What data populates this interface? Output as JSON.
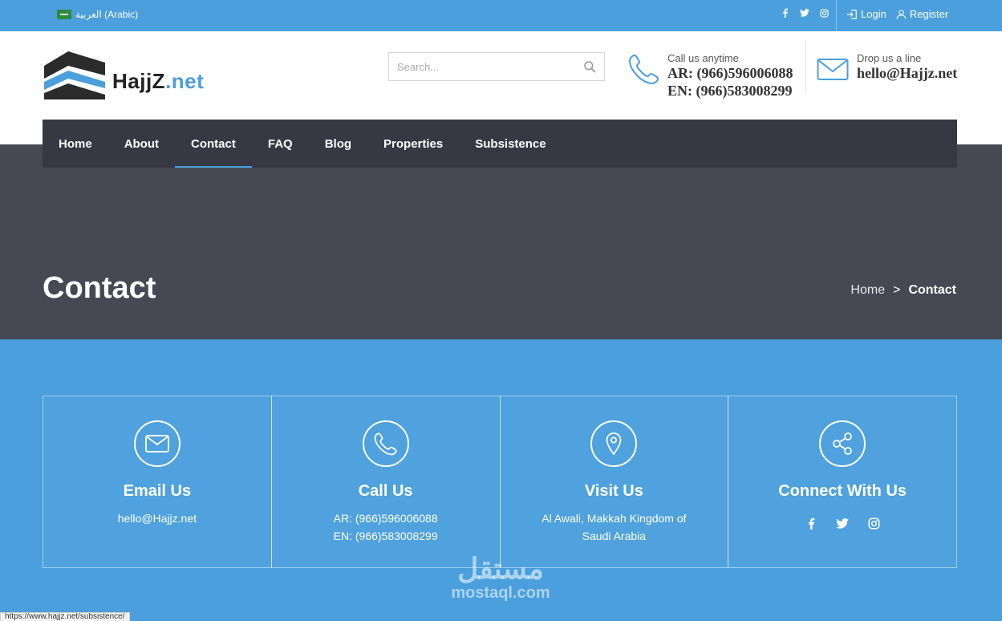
{
  "topbar": {
    "language_label": "العربية (Arabic)",
    "social_icons": [
      "facebook-icon",
      "twitter-icon",
      "instagram-icon"
    ],
    "login_label": "Login",
    "register_label": "Register"
  },
  "logo": {
    "name": "HajjZ",
    "suffix": ".net"
  },
  "search": {
    "placeholder": "Search..."
  },
  "call": {
    "label": "Call us anytime",
    "ar": "AR: (966)596006088",
    "en": "EN: (966)583008299"
  },
  "mail": {
    "label": "Drop us a line",
    "email": "hello@Hajjz.net"
  },
  "nav": {
    "items": [
      "Home",
      "About",
      "Contact",
      "FAQ",
      "Blog",
      "Properties",
      "Subsistence"
    ],
    "active": "Contact"
  },
  "hero": {
    "title": "Contact",
    "breadcrumb": {
      "home": "Home",
      "separator": ">",
      "current": "Contact"
    }
  },
  "cards": [
    {
      "title": "Email Us",
      "lines": [
        "hello@Hajjz.net"
      ],
      "icon": "envelope-icon"
    },
    {
      "title": "Call Us",
      "lines": [
        "AR: (966)596006088",
        "EN: (966)583008299"
      ],
      "icon": "phone-icon"
    },
    {
      "title": "Visit Us",
      "lines": [
        "Al Awali, Makkah Kingdom of",
        "Saudi Arabia"
      ],
      "icon": "map-pin-icon"
    },
    {
      "title": "Connect With Us",
      "lines": [],
      "icon": "share-icon"
    }
  ],
  "watermark": {
    "ar": "مستقل",
    "en": "mostaql.com"
  },
  "status_url": "https://www.hajjz.net/subsistence/",
  "colors": {
    "accent": "#4a9fdc",
    "nav_bg": "#363944",
    "hero_bg": "#464954"
  }
}
